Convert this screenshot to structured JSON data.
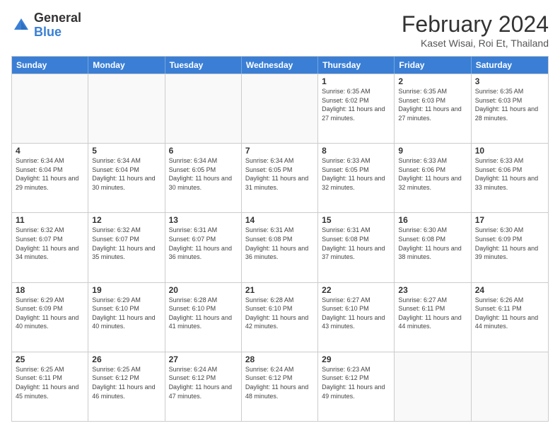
{
  "header": {
    "logo_general": "General",
    "logo_blue": "Blue",
    "title": "February 2024",
    "location": "Kaset Wisai, Roi Et, Thailand"
  },
  "calendar": {
    "days_of_week": [
      "Sunday",
      "Monday",
      "Tuesday",
      "Wednesday",
      "Thursday",
      "Friday",
      "Saturday"
    ],
    "weeks": [
      [
        {
          "day": "",
          "empty": true
        },
        {
          "day": "",
          "empty": true
        },
        {
          "day": "",
          "empty": true
        },
        {
          "day": "",
          "empty": true
        },
        {
          "day": "1",
          "sunrise": "6:35 AM",
          "sunset": "6:02 PM",
          "daylight": "11 hours and 27 minutes."
        },
        {
          "day": "2",
          "sunrise": "6:35 AM",
          "sunset": "6:03 PM",
          "daylight": "11 hours and 27 minutes."
        },
        {
          "day": "3",
          "sunrise": "6:35 AM",
          "sunset": "6:03 PM",
          "daylight": "11 hours and 28 minutes."
        }
      ],
      [
        {
          "day": "4",
          "sunrise": "6:34 AM",
          "sunset": "6:04 PM",
          "daylight": "11 hours and 29 minutes."
        },
        {
          "day": "5",
          "sunrise": "6:34 AM",
          "sunset": "6:04 PM",
          "daylight": "11 hours and 30 minutes."
        },
        {
          "day": "6",
          "sunrise": "6:34 AM",
          "sunset": "6:05 PM",
          "daylight": "11 hours and 30 minutes."
        },
        {
          "day": "7",
          "sunrise": "6:34 AM",
          "sunset": "6:05 PM",
          "daylight": "11 hours and 31 minutes."
        },
        {
          "day": "8",
          "sunrise": "6:33 AM",
          "sunset": "6:05 PM",
          "daylight": "11 hours and 32 minutes."
        },
        {
          "day": "9",
          "sunrise": "6:33 AM",
          "sunset": "6:06 PM",
          "daylight": "11 hours and 32 minutes."
        },
        {
          "day": "10",
          "sunrise": "6:33 AM",
          "sunset": "6:06 PM",
          "daylight": "11 hours and 33 minutes."
        }
      ],
      [
        {
          "day": "11",
          "sunrise": "6:32 AM",
          "sunset": "6:07 PM",
          "daylight": "11 hours and 34 minutes."
        },
        {
          "day": "12",
          "sunrise": "6:32 AM",
          "sunset": "6:07 PM",
          "daylight": "11 hours and 35 minutes."
        },
        {
          "day": "13",
          "sunrise": "6:31 AM",
          "sunset": "6:07 PM",
          "daylight": "11 hours and 36 minutes."
        },
        {
          "day": "14",
          "sunrise": "6:31 AM",
          "sunset": "6:08 PM",
          "daylight": "11 hours and 36 minutes."
        },
        {
          "day": "15",
          "sunrise": "6:31 AM",
          "sunset": "6:08 PM",
          "daylight": "11 hours and 37 minutes."
        },
        {
          "day": "16",
          "sunrise": "6:30 AM",
          "sunset": "6:08 PM",
          "daylight": "11 hours and 38 minutes."
        },
        {
          "day": "17",
          "sunrise": "6:30 AM",
          "sunset": "6:09 PM",
          "daylight": "11 hours and 39 minutes."
        }
      ],
      [
        {
          "day": "18",
          "sunrise": "6:29 AM",
          "sunset": "6:09 PM",
          "daylight": "11 hours and 40 minutes."
        },
        {
          "day": "19",
          "sunrise": "6:29 AM",
          "sunset": "6:10 PM",
          "daylight": "11 hours and 40 minutes."
        },
        {
          "day": "20",
          "sunrise": "6:28 AM",
          "sunset": "6:10 PM",
          "daylight": "11 hours and 41 minutes."
        },
        {
          "day": "21",
          "sunrise": "6:28 AM",
          "sunset": "6:10 PM",
          "daylight": "11 hours and 42 minutes."
        },
        {
          "day": "22",
          "sunrise": "6:27 AM",
          "sunset": "6:10 PM",
          "daylight": "11 hours and 43 minutes."
        },
        {
          "day": "23",
          "sunrise": "6:27 AM",
          "sunset": "6:11 PM",
          "daylight": "11 hours and 44 minutes."
        },
        {
          "day": "24",
          "sunrise": "6:26 AM",
          "sunset": "6:11 PM",
          "daylight": "11 hours and 44 minutes."
        }
      ],
      [
        {
          "day": "25",
          "sunrise": "6:25 AM",
          "sunset": "6:11 PM",
          "daylight": "11 hours and 45 minutes."
        },
        {
          "day": "26",
          "sunrise": "6:25 AM",
          "sunset": "6:12 PM",
          "daylight": "11 hours and 46 minutes."
        },
        {
          "day": "27",
          "sunrise": "6:24 AM",
          "sunset": "6:12 PM",
          "daylight": "11 hours and 47 minutes."
        },
        {
          "day": "28",
          "sunrise": "6:24 AM",
          "sunset": "6:12 PM",
          "daylight": "11 hours and 48 minutes."
        },
        {
          "day": "29",
          "sunrise": "6:23 AM",
          "sunset": "6:12 PM",
          "daylight": "11 hours and 49 minutes."
        },
        {
          "day": "",
          "empty": true
        },
        {
          "day": "",
          "empty": true
        }
      ]
    ]
  }
}
